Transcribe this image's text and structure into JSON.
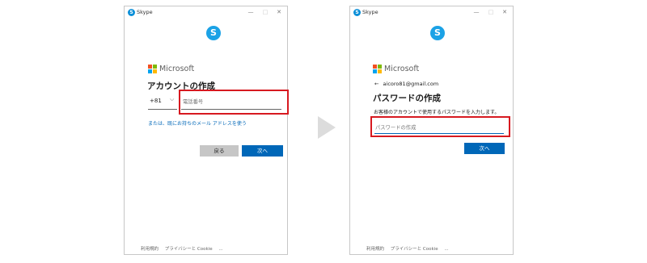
{
  "window1": {
    "title": "Skype",
    "brand": "Microsoft",
    "heading": "アカウントの作成",
    "country_code": "+81",
    "phone_placeholder": "電話番号",
    "alt_link": "または、既にお持ちのメール アドレスを使う",
    "back_label": "戻る",
    "next_label": "次へ",
    "footer": {
      "terms": "利用規約",
      "privacy": "プライバシーと Cookie",
      "more": "..."
    }
  },
  "window2": {
    "title": "Skype",
    "brand": "Microsoft",
    "email": "aicoro81@gmail.com",
    "back_arrow": "←",
    "heading": "パスワードの作成",
    "description": "お客様のアカウントで使用するパスワードを入力します。",
    "password_placeholder": "パスワードの作成",
    "next_label": "次へ",
    "footer": {
      "terms": "利用規約",
      "privacy": "プライバシーと Cookie",
      "more": "..."
    }
  },
  "window_controls": {
    "minimize": "—",
    "maximize": "□",
    "close": "✕"
  },
  "icons": {
    "skype_letter": "S",
    "chevron": "⌵",
    "app_icon": "skype-icon",
    "step_arrow": "play-arrow-icon"
  },
  "colors": {
    "accent": "#0067b8",
    "highlight": "#d71920",
    "skype": "#1ba2e6"
  }
}
